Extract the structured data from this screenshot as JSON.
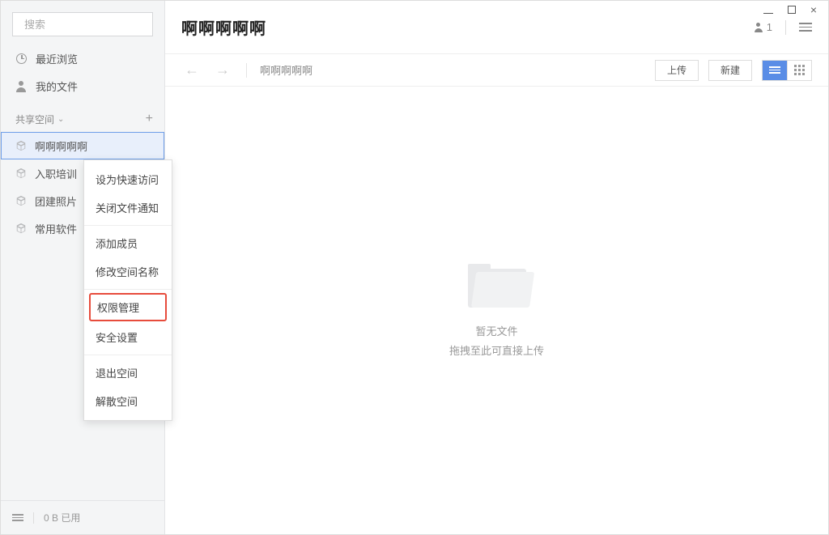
{
  "search": {
    "placeholder": "搜索"
  },
  "nav": {
    "recent": "最近浏览",
    "myfiles": "我的文件"
  },
  "section": {
    "title": "共享空间",
    "add": "+"
  },
  "spaces": [
    {
      "name": "啊啊啊啊啊"
    },
    {
      "name": "入职培训"
    },
    {
      "name": "团建照片"
    },
    {
      "name": "常用软件"
    }
  ],
  "footer": {
    "storage": "0 B 已用"
  },
  "header": {
    "title": "啊啊啊啊啊",
    "member_count": "1"
  },
  "toolbar": {
    "breadcrumb": "啊啊啊啊啊",
    "upload": "上传",
    "new": "新建"
  },
  "empty": {
    "title": "暂无文件",
    "subtitle": "拖拽至此可直接上传"
  },
  "context_menu": {
    "quick_access": "设为快速访问",
    "close_notify": "关闭文件通知",
    "add_member": "添加成员",
    "rename": "修改空间名称",
    "permissions": "权限管理",
    "security": "安全设置",
    "exit": "退出空间",
    "dissolve": "解散空间"
  }
}
